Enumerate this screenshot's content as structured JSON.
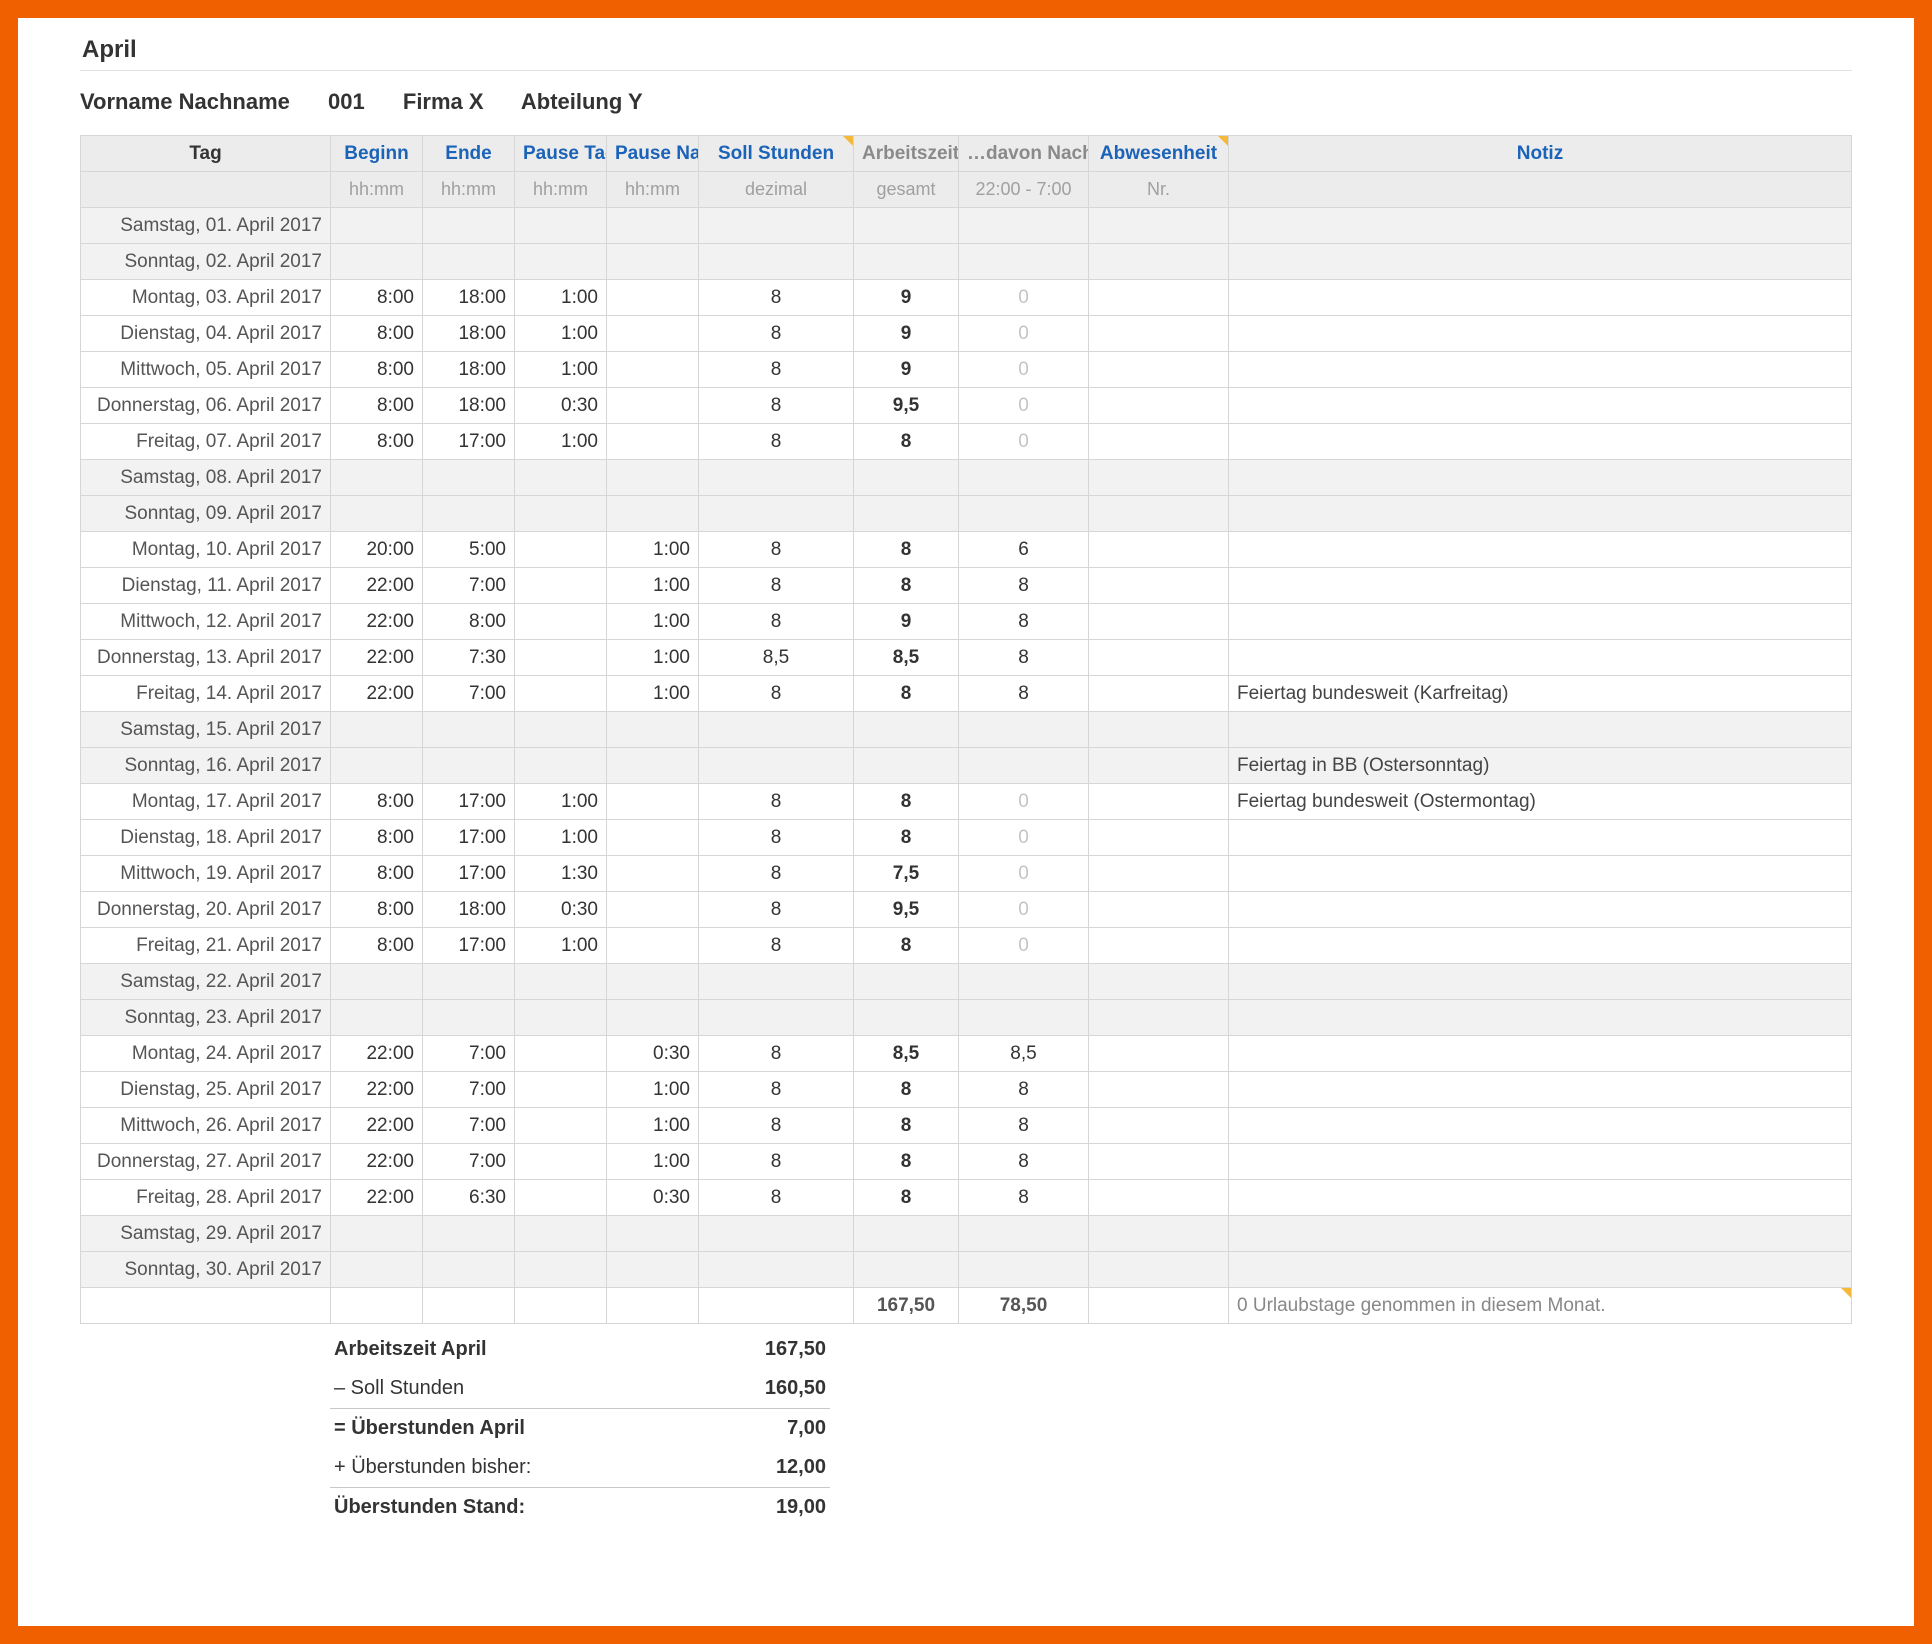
{
  "month_title": "April",
  "info": {
    "person": "Vorname Nachname",
    "number": "001",
    "company": "Firma X",
    "department": "Abteilung Y"
  },
  "headers": {
    "day": "Tag",
    "begin": "Beginn",
    "end": "Ende",
    "pauseDay": "Pause Tag",
    "pauseNight": "Pause Nacht",
    "soll": "Soll Stunden",
    "arbeit": "Arbeitszeit",
    "nacht": "…davon Nachtzeit",
    "abw": "Abwesenheit",
    "note": "Notiz",
    "sub_hhmm": "hh:mm",
    "sub_dez": "dezimal",
    "sub_gesamt": "gesamt",
    "sub_night": "22:00 - 7:00",
    "sub_nr": "Nr."
  },
  "rows": [
    {
      "weekend": true,
      "day": "Samstag, 01. April 2017"
    },
    {
      "weekend": true,
      "day": "Sonntag, 02. April 2017"
    },
    {
      "day": "Montag, 03. April 2017",
      "b": "8:00",
      "e": "18:00",
      "pd": "1:00",
      "soll": "8",
      "az": "9",
      "nz": "0",
      "nzGhost": true
    },
    {
      "day": "Dienstag, 04. April 2017",
      "b": "8:00",
      "e": "18:00",
      "pd": "1:00",
      "soll": "8",
      "az": "9",
      "nz": "0",
      "nzGhost": true
    },
    {
      "day": "Mittwoch, 05. April 2017",
      "b": "8:00",
      "e": "18:00",
      "pd": "1:00",
      "soll": "8",
      "az": "9",
      "nz": "0",
      "nzGhost": true
    },
    {
      "day": "Donnerstag, 06. April 2017",
      "b": "8:00",
      "e": "18:00",
      "pd": "0:30",
      "soll": "8",
      "az": "9,5",
      "nz": "0",
      "nzGhost": true
    },
    {
      "day": "Freitag, 07. April 2017",
      "b": "8:00",
      "e": "17:00",
      "pd": "1:00",
      "soll": "8",
      "az": "8",
      "nz": "0",
      "nzGhost": true
    },
    {
      "weekend": true,
      "day": "Samstag, 08. April 2017"
    },
    {
      "weekend": true,
      "day": "Sonntag, 09. April 2017"
    },
    {
      "day": "Montag, 10. April 2017",
      "b": "20:00",
      "e": "5:00",
      "pn": "1:00",
      "soll": "8",
      "az": "8",
      "nz": "6"
    },
    {
      "day": "Dienstag, 11. April 2017",
      "b": "22:00",
      "e": "7:00",
      "pn": "1:00",
      "soll": "8",
      "az": "8",
      "nz": "8"
    },
    {
      "day": "Mittwoch, 12. April 2017",
      "b": "22:00",
      "e": "8:00",
      "pn": "1:00",
      "soll": "8",
      "az": "9",
      "nz": "8"
    },
    {
      "day": "Donnerstag, 13. April 2017",
      "b": "22:00",
      "e": "7:30",
      "pn": "1:00",
      "soll": "8,5",
      "az": "8,5",
      "nz": "8"
    },
    {
      "day": "Freitag, 14. April 2017",
      "b": "22:00",
      "e": "7:00",
      "pn": "1:00",
      "soll": "8",
      "az": "8",
      "nz": "8",
      "note": "Feiertag bundesweit (Karfreitag)"
    },
    {
      "weekend": true,
      "day": "Samstag, 15. April 2017"
    },
    {
      "weekend": true,
      "day": "Sonntag, 16. April 2017",
      "note": "Feiertag in BB (Ostersonntag)"
    },
    {
      "day": "Montag, 17. April 2017",
      "b": "8:00",
      "e": "17:00",
      "pd": "1:00",
      "soll": "8",
      "az": "8",
      "nz": "0",
      "nzGhost": true,
      "note": "Feiertag bundesweit (Ostermontag)"
    },
    {
      "day": "Dienstag, 18. April 2017",
      "b": "8:00",
      "e": "17:00",
      "pd": "1:00",
      "soll": "8",
      "az": "8",
      "nz": "0",
      "nzGhost": true
    },
    {
      "day": "Mittwoch, 19. April 2017",
      "b": "8:00",
      "e": "17:00",
      "pd": "1:30",
      "soll": "8",
      "az": "7,5",
      "nz": "0",
      "nzGhost": true
    },
    {
      "day": "Donnerstag, 20. April 2017",
      "b": "8:00",
      "e": "18:00",
      "pd": "0:30",
      "soll": "8",
      "az": "9,5",
      "nz": "0",
      "nzGhost": true
    },
    {
      "day": "Freitag, 21. April 2017",
      "b": "8:00",
      "e": "17:00",
      "pd": "1:00",
      "soll": "8",
      "az": "8",
      "nz": "0",
      "nzGhost": true
    },
    {
      "weekend": true,
      "day": "Samstag, 22. April 2017"
    },
    {
      "weekend": true,
      "day": "Sonntag, 23. April 2017"
    },
    {
      "day": "Montag, 24. April 2017",
      "b": "22:00",
      "e": "7:00",
      "pn": "0:30",
      "soll": "8",
      "az": "8,5",
      "nz": "8,5"
    },
    {
      "day": "Dienstag, 25. April 2017",
      "b": "22:00",
      "e": "7:00",
      "pn": "1:00",
      "soll": "8",
      "az": "8",
      "nz": "8"
    },
    {
      "day": "Mittwoch, 26. April 2017",
      "b": "22:00",
      "e": "7:00",
      "pn": "1:00",
      "soll": "8",
      "az": "8",
      "nz": "8"
    },
    {
      "day": "Donnerstag, 27. April 2017",
      "b": "22:00",
      "e": "7:00",
      "pn": "1:00",
      "soll": "8",
      "az": "8",
      "nz": "8"
    },
    {
      "day": "Freitag, 28. April 2017",
      "b": "22:00",
      "e": "6:30",
      "pn": "0:30",
      "soll": "8",
      "az": "8",
      "nz": "8"
    },
    {
      "weekend": true,
      "day": "Samstag, 29. April 2017"
    },
    {
      "weekend": true,
      "day": "Sonntag, 30. April 2017"
    }
  ],
  "totals": {
    "arbeit": "167,50",
    "nacht": "78,50",
    "vacation_msg": "0 Urlaubstage genommen in diesem Monat."
  },
  "summary": {
    "l1": "Arbeitszeit April",
    "v1": "167,50",
    "l2": "– Soll Stunden",
    "v2": "160,50",
    "l3": "= Überstunden April",
    "v3": "7,00",
    "l4": "+ Überstunden bisher:",
    "v4": "12,00",
    "l5": "Überstunden Stand:",
    "v5": "19,00"
  }
}
